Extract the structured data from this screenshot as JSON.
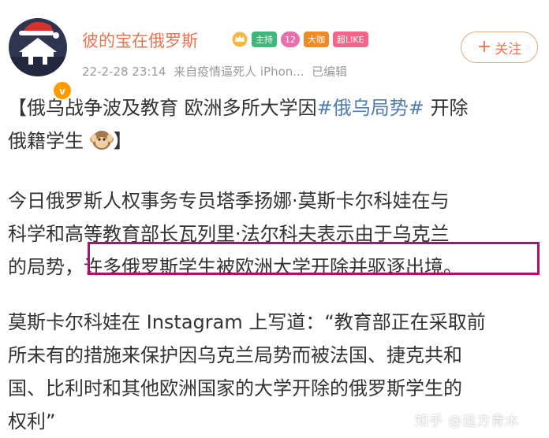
{
  "post": {
    "username": "彼的宝在俄罗斯",
    "badges": [
      "主持",
      "12",
      "大咖",
      "超LIKE"
    ],
    "verified_mark": "v",
    "timestamp": "22-2-28 23:14",
    "source": "来自疫情逼死人 iPhon...",
    "edited": "已编辑",
    "follow_label": "关注",
    "title_line1_before": "【俄乌战争波及教育 欧洲多所大学因",
    "hashtag": "#俄乌局势#",
    "title_line1_after": " 开除",
    "title_line2": "俄籍学生",
    "title_line2_end": "】",
    "para1_line1": "今日俄罗斯人权事务专员塔季扬娜·莫斯卡尔科娃在与",
    "para1_line2": "科学和高等教育部长瓦列里·法尔科夫表示由于乌克兰",
    "para1_line3_prefix": "的局势，",
    "para1_line3_highlight": "许多俄罗斯学生被欧洲大学开除并驱逐出境。",
    "para2_line1": "莫斯卡尔科娃在 Instagram 上写道：“教育部正在采取前",
    "para2_line2": "所未有的措施来保护因乌克兰局势而被法国、捷克共和",
    "para2_line3": "国、比利时和其他欧洲国家的大学开除的俄罗斯学生的",
    "para2_line4": "权利”"
  },
  "watermark": "知乎 @远方青木",
  "icons": [
    "avatar-logo",
    "verified-icon",
    "crown-icon",
    "monkey-emoji"
  ],
  "colors": {
    "username": "#eb7350",
    "hashtag": "#507daf",
    "highlight_border": "#b0106a",
    "meta": "#9a9a9a"
  }
}
